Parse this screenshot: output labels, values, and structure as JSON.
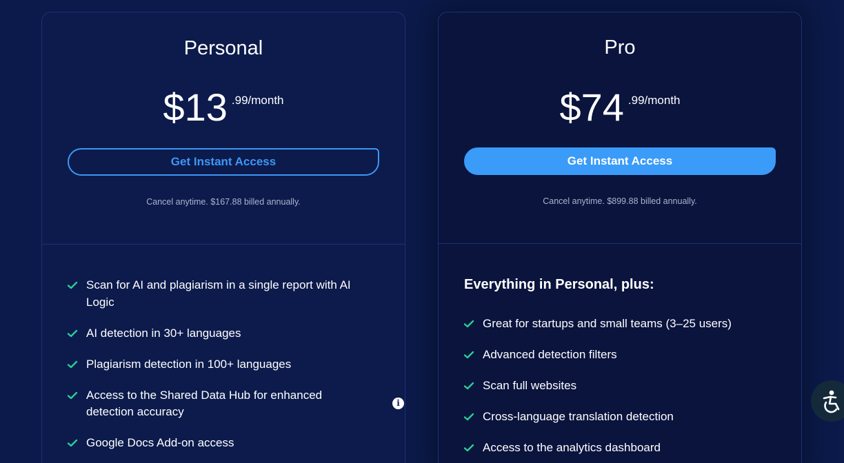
{
  "plans": {
    "personal": {
      "name": "Personal",
      "price_main": "$13",
      "price_cents": ".99/month",
      "cta_label": "Get Instant Access",
      "billing_note": "Cancel anytime. $167.88 billed annually.",
      "features": [
        "Scan for AI and plagiarism in a single report with AI Logic",
        "AI detection in 30+ languages",
        "Plagiarism detection in 100+ languages",
        "Access to the Shared Data Hub for enhanced detection accuracy",
        "Google Docs Add-on access"
      ]
    },
    "pro": {
      "name": "Pro",
      "price_main": "$74",
      "price_cents": ".99/month",
      "cta_label": "Get Instant Access",
      "billing_note": "Cancel anytime. $899.88 billed annually.",
      "features_heading": "Everything in Personal, plus:",
      "features": [
        "Great for startups and small teams (3–25 users)",
        "Advanced detection filters",
        "Scan full websites",
        "Cross-language translation detection",
        "Access to the analytics dashboard"
      ]
    }
  },
  "icons": {
    "check": "check-icon",
    "info": "info-icon",
    "accessibility": "accessibility-icon"
  },
  "colors": {
    "background": "#0b1a4a",
    "accent_blue": "#3a9bf8",
    "check_green": "#2ecc9a",
    "muted_text": "#a9b3cf"
  }
}
